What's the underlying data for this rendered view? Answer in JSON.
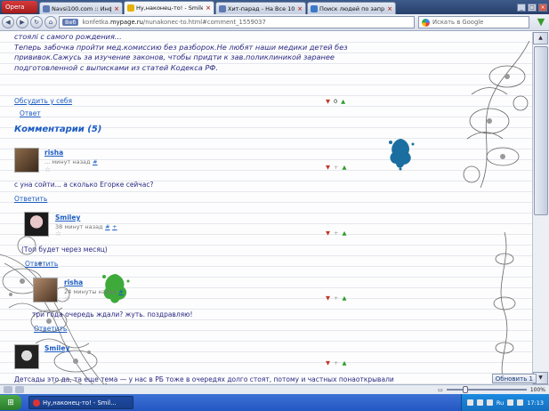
{
  "browser": {
    "menu_label": "Opera",
    "tabs": [
      {
        "label": "Navsi100.com :: Инф...",
        "color": "#5e7ab4"
      },
      {
        "label": "Ну,наконец-то! - Smiley",
        "color": "#e6b100",
        "active": true
      },
      {
        "label": "Хит-парад - На Все 100 (...",
        "color": "#5e7ab4"
      },
      {
        "label": "Поиск людей по запрос...",
        "color": "#3a78c8"
      }
    ],
    "back_icon": "back-arrow-icon",
    "forward_icon": "forward-arrow-icon",
    "address_prefix": "Веб",
    "address_pre": "konfetka.",
    "address_domain": "mypage.ru",
    "address_post": "/nunakonec-to.html#comment_1559037",
    "search_placeholder": "Искать в Google"
  },
  "post": {
    "lines": [
      "стоялі с самого рождения...",
      "Теперь забочка пройти мед.комиссию без разборок.Не любят наши медики детей без",
      "прививок.Сажусь за изучение законов, чтобы придти к зав.поликлиникой заранее",
      "подготовленной с выписками из статей Кодекса РФ."
    ],
    "discuss_link": "Обсудить у себя",
    "sub_link": "Ответ",
    "rating": "0"
  },
  "comments_heading": "Комментарии (5)",
  "comments": [
    {
      "user": "risha",
      "time": "... минут назад",
      "hash": "#",
      "text": "с уна сойти... а сколько Егорке сейчас?",
      "reply": "Ответить"
    },
    {
      "user": "Smiley",
      "time": "38 минут назад",
      "hash": "#",
      "plus": "+",
      "text": "(Топ будет через месяц)",
      "reply": "Ответить"
    },
    {
      "user": "risha",
      "time": "24 минуты назад",
      "hash": "#",
      "text": "три года очередь ждали? жуть. поздравляю!",
      "reply": "Ответить"
    },
    {
      "user": "Smiley",
      "time": "",
      "hash": "",
      "text": "Детсады это да, та еще тема — у нас в РБ тоже в очередях долго стоят, потому и частных понаоткрывали",
      "reply": ""
    }
  ],
  "statusbar": {
    "refresh_label": "Обновить 1",
    "zoom": "100%"
  },
  "taskbar": {
    "start_icon": "windows-start-icon",
    "task_label": "Ну,наконец-то! - Smil...",
    "lang": "Ru",
    "clock": "17:13"
  },
  "colors": {
    "link": "#1b5bc2",
    "text": "#2a2a84",
    "taskbar": "#2457c1"
  }
}
